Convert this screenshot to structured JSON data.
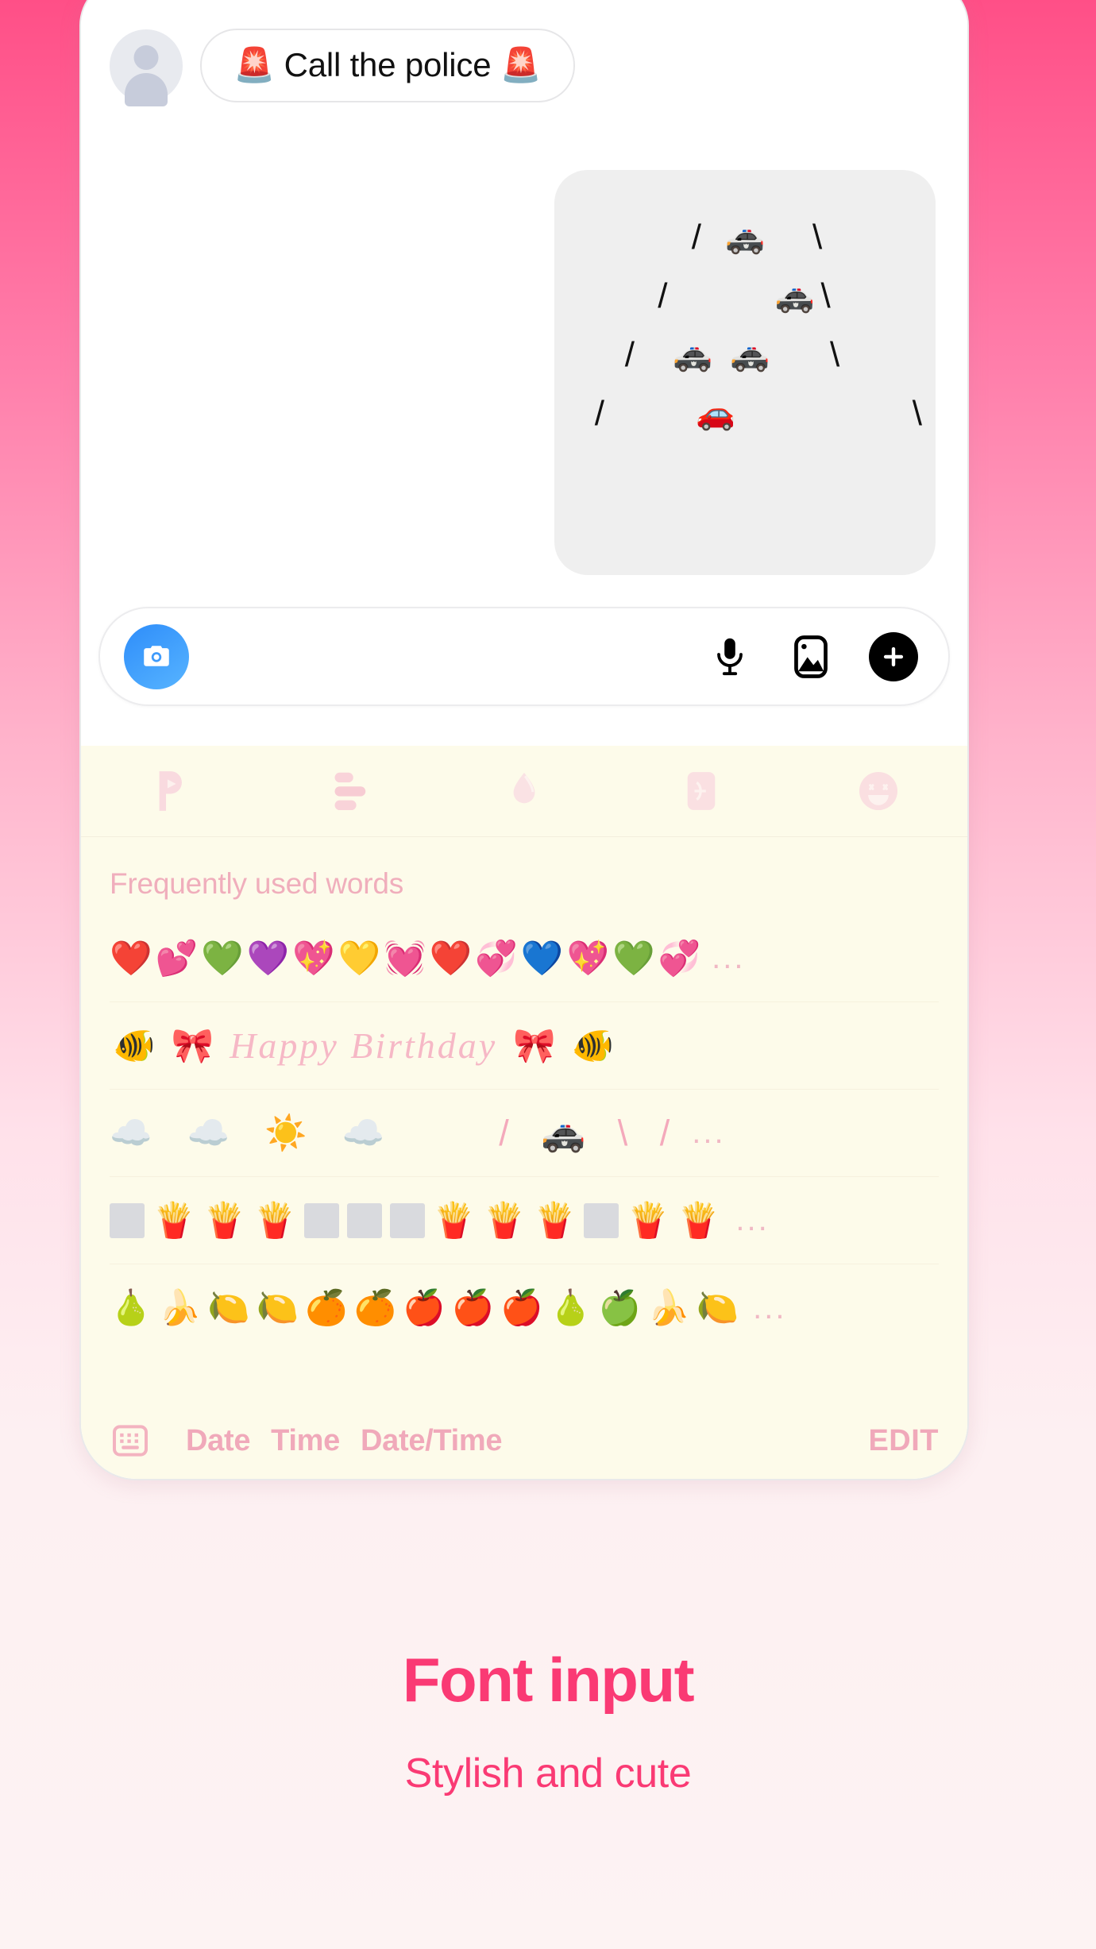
{
  "background": {
    "top_color": "#ff4f87",
    "bottom_color": "#fdf3f3"
  },
  "chat": {
    "message": {
      "avatar": "default-avatar",
      "text": "🚨 Call the police 🚨"
    },
    "art_card": {
      "lines": [
        {
          "left": "/",
          "mid": "🚓",
          "right": "\\"
        },
        {
          "left": "/",
          "mid": "🚓",
          "right": "\\"
        },
        {
          "left": "/",
          "mid": "🚓🚓",
          "right": "\\"
        },
        {
          "left": "/",
          "mid": "🚗",
          "right": "\\"
        }
      ]
    }
  },
  "input_bar": {
    "camera_icon": "camera-icon",
    "mic_icon": "microphone-icon",
    "photo_icon": "photo-icon",
    "plus_icon": "plus-icon",
    "placeholder": ""
  },
  "keyboard": {
    "top_tabs": [
      {
        "name": "tab-sticker-p",
        "icon": "p-letter-icon"
      },
      {
        "name": "tab-lines",
        "icon": "lines-icon"
      },
      {
        "name": "tab-drop",
        "icon": "drop-icon"
      },
      {
        "name": "tab-translate",
        "icon": "translate-icon"
      },
      {
        "name": "tab-emoji",
        "icon": "smiley-icon"
      }
    ],
    "section_title": "Frequently used words",
    "rows": [
      {
        "name": "hearts-row",
        "items": [
          "❤️",
          "💕",
          "💚",
          "💜",
          "💖",
          "💛",
          "💓",
          "❤️",
          "💞",
          "💙",
          "💖",
          "💚",
          "💞"
        ],
        "more": "..."
      },
      {
        "name": "birthday-row",
        "prefix": [
          "🐠",
          "🎀"
        ],
        "text": "Happy Birthday",
        "suffix": [
          "🎀",
          "🐠"
        ],
        "more": ""
      },
      {
        "name": "weather-row",
        "items": [
          "☁️",
          "☁️",
          "☀️",
          "☁️"
        ],
        "art": "/ 🚓 \\    /",
        "more": "..."
      },
      {
        "name": "fries-row",
        "items": [
          "▢",
          "🍟",
          "🍟",
          "🍟",
          "▢",
          "▢",
          "▢",
          "🍟",
          "🍟",
          "🍟",
          "▢",
          "🍟",
          "🍟"
        ],
        "more": "..."
      },
      {
        "name": "fruit-row",
        "items": [
          "🍐",
          "🍌",
          "🍋",
          "🍋",
          "🍊",
          "🍊",
          "🍎",
          "🍎",
          "🍎",
          "🍐",
          "🍏",
          "🍌",
          "🍋"
        ],
        "more": "..."
      }
    ],
    "footer": {
      "keyboard_icon": "keyboard-icon",
      "links": [
        "Date",
        "Time",
        "Date/Time"
      ],
      "edit_label": "EDIT"
    }
  },
  "promo": {
    "title": "Font input",
    "subtitle": "Stylish and cute",
    "accent_color": "#fa3a74"
  }
}
